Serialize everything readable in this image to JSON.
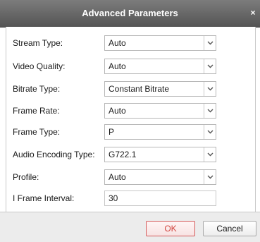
{
  "dialog": {
    "title": "Advanced Parameters",
    "close_glyph": "×"
  },
  "fields": [
    {
      "label": "Stream Type:",
      "value": "Auto",
      "kind": "select"
    },
    {
      "label": "Video Quality:",
      "value": "Auto",
      "kind": "select"
    },
    {
      "label": "Bitrate Type:",
      "value": "Constant Bitrate",
      "kind": "select"
    },
    {
      "label": "Frame Rate:",
      "value": "Auto",
      "kind": "select"
    },
    {
      "label": "Frame Type:",
      "value": "P",
      "kind": "select"
    },
    {
      "label": "Audio Encoding Type:",
      "value": "G722.1",
      "kind": "select"
    },
    {
      "label": "Profile:",
      "value": "Auto",
      "kind": "select"
    },
    {
      "label": "I Frame Interval:",
      "value": "30",
      "kind": "input"
    }
  ],
  "buttons": {
    "ok_label": "OK",
    "cancel_label": "Cancel"
  },
  "colors": {
    "titlebar": "#545454",
    "ok_accent": "#d35b5b"
  },
  "icons": {
    "dropdown": "chevron-down-icon",
    "close": "close-icon"
  }
}
